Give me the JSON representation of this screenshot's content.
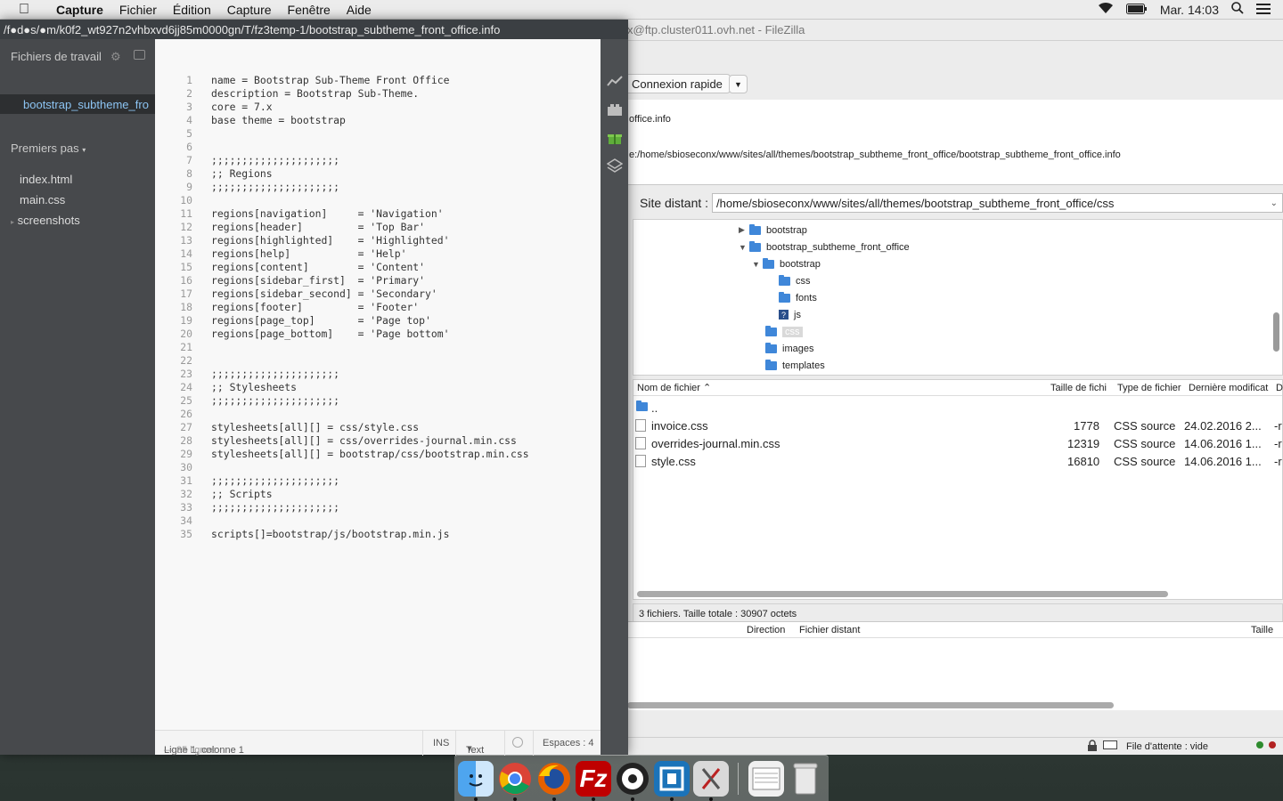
{
  "menubar": {
    "apple": "",
    "items": [
      "Capture",
      "Fichier",
      "Édition",
      "Capture",
      "Fenêtre",
      "Aide"
    ],
    "clock": "Mar. 14:03"
  },
  "brackets": {
    "title": "/f●d●s/●m/k0f2_wt927n2vhbxvd6jj85m0000gn/T/fz3temp-1/bootstrap_subtheme_front_office.info",
    "working_files_label": "Fichiers de travail",
    "working_file": "bootstrap_subtheme_fro",
    "project_label": "Premiers pas",
    "project_files": [
      "index.html",
      "main.css",
      "screenshots"
    ],
    "code": [
      "name = Bootstrap Sub-Theme Front Office",
      "description = Bootstrap Sub-Theme.",
      "core = 7.x",
      "base theme = bootstrap",
      "",
      "",
      ";;;;;;;;;;;;;;;;;;;;;",
      ";; Regions",
      ";;;;;;;;;;;;;;;;;;;;;",
      "",
      "regions[navigation]     = 'Navigation'",
      "regions[header]         = 'Top Bar'",
      "regions[highlighted]    = 'Highlighted'",
      "regions[help]           = 'Help'",
      "regions[content]        = 'Content'",
      "regions[sidebar_first]  = 'Primary'",
      "regions[sidebar_second] = 'Secondary'",
      "regions[footer]         = 'Footer'",
      "regions[page_top]       = 'Page top'",
      "regions[page_bottom]    = 'Page bottom'",
      "",
      "",
      ";;;;;;;;;;;;;;;;;;;;;",
      ";; Stylesheets",
      ";;;;;;;;;;;;;;;;;;;;;",
      "",
      "stylesheets[all][] = css/style.css",
      "stylesheets[all][] = css/overrides-journal.min.css",
      "stylesheets[all][] = bootstrap/css/bootstrap.min.css",
      "",
      ";;;;;;;;;;;;;;;;;;;;;",
      ";; Scripts",
      ";;;;;;;;;;;;;;;;;;;;;",
      "",
      "scripts[]=bootstrap/js/bootstrap.min.js"
    ],
    "status": {
      "cursor": "Ligne 1, colonne 1",
      "lines": " — 35 lignes",
      "mode": "INS",
      "language": "Text",
      "spaces": "Espaces : 4"
    }
  },
  "filezilla": {
    "title": "x@ftp.cluster011.ovh.net - FileZilla",
    "quickconnect": "Connexion rapide",
    "log": [
      "office.info",
      "e:/home/sbioseconx/www/sites/all/themes/bootstrap_subtheme_front_office/bootstrap_subtheme_front_office.info"
    ],
    "remote_site_label": "Site distant :",
    "remote_path": "/home/sbioseconx/www/sites/all/themes/bootstrap_subtheme_front_office/css",
    "tree": [
      "bootstrap",
      "bootstrap_subtheme_front_office",
      "bootstrap",
      "css",
      "fonts",
      "js",
      "css",
      "images",
      "templates"
    ],
    "columns": [
      "Nom de fichier",
      "Taille de fichi",
      "Type de fichier",
      "Dernière modificat",
      "D"
    ],
    "files": [
      {
        "name": "..",
        "size": "",
        "type": "",
        "date": "",
        "perm": ""
      },
      {
        "name": "invoice.css",
        "size": "1778",
        "type": "CSS source",
        "date": "24.02.2016 2...",
        "perm": "-r"
      },
      {
        "name": "overrides-journal.min.css",
        "size": "12319",
        "type": "CSS source",
        "date": "14.06.2016 1...",
        "perm": "-r"
      },
      {
        "name": "style.css",
        "size": "16810",
        "type": "CSS source",
        "date": "14.06.2016 1...",
        "perm": "-r"
      }
    ],
    "status_text": "3 fichiers. Taille totale : 30907 octets",
    "queue_columns": [
      "Direction",
      "Fichier distant",
      "Taille"
    ],
    "queue_status": "File d'attente : vide"
  }
}
